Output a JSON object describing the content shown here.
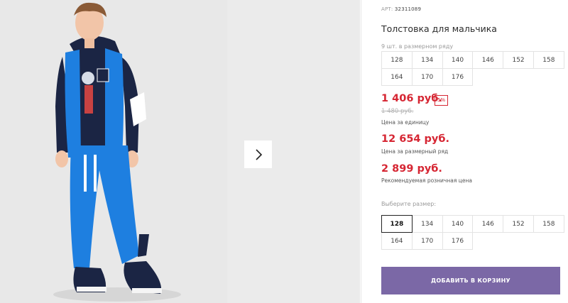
{
  "product": {
    "sku_label": "АРТ:",
    "sku_value": "32311089",
    "title": "Толстовка для мальчика",
    "range_label": "9 шт. в размерном ряду",
    "range_sizes": [
      "128",
      "134",
      "140",
      "146",
      "152",
      "158",
      "164",
      "170",
      "176"
    ],
    "price": "1 406 руб.",
    "discount": "5%",
    "old_price": "1 480 руб.",
    "price_caption": "Цена за единицу",
    "set_price": "12 654 руб.",
    "set_caption": "Цена за размерный ряд",
    "rrp_price": "2 899 руб.",
    "rrp_caption": "Рекомендуемая розничная цена",
    "choose_label": "Выберите размер:",
    "sizes": [
      "128",
      "134",
      "140",
      "146",
      "152",
      "158",
      "164",
      "170",
      "176"
    ],
    "selected_size": "128",
    "add_to_cart": "ДОБАВИТЬ В КОРЗИНУ"
  },
  "gallery": {
    "next_icon": "chevron-right-icon"
  },
  "colors": {
    "price_red": "#d62633",
    "button_purple": "#7b68a6",
    "garment_blue": "#1e7fe0",
    "garment_navy": "#1b2544"
  }
}
